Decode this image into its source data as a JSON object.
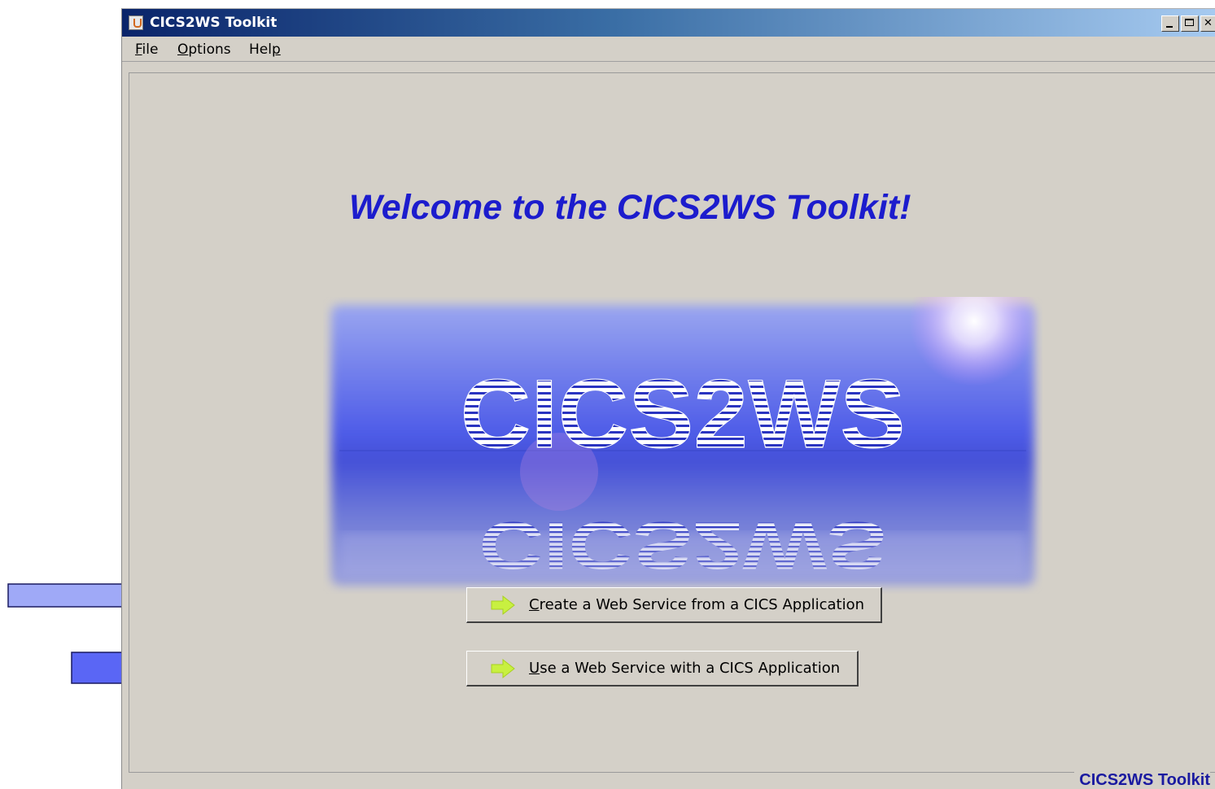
{
  "window": {
    "title": "CICS2WS Toolkit",
    "controls": [
      "minimize-icon",
      "maximize-icon",
      "close-icon"
    ]
  },
  "menu": {
    "file": {
      "mnemonic": "F",
      "rest": "ile"
    },
    "options": {
      "mnemonic": "O",
      "rest": "ptions"
    },
    "help": {
      "prefix": "Hel",
      "mnemonic": "p"
    }
  },
  "main": {
    "welcome": "Welcome to the CICS2WS Toolkit!",
    "logo_text": "CICS2WS",
    "buttons": {
      "create": {
        "mnemonic": "C",
        "rest": "reate a Web Service from a CICS Application",
        "icon": "green-arrow-icon"
      },
      "use": {
        "mnemonic": "U",
        "rest": "se a Web Service with a CICS Application",
        "icon": "green-arrow-icon"
      }
    },
    "footer": "CICS2WS Toolkit"
  },
  "colors": {
    "welcome_text": "#1c1ccd",
    "callout_light": "#9fa9f7",
    "callout_dark": "#5a66f5",
    "button_arrow": "#c8f040"
  }
}
